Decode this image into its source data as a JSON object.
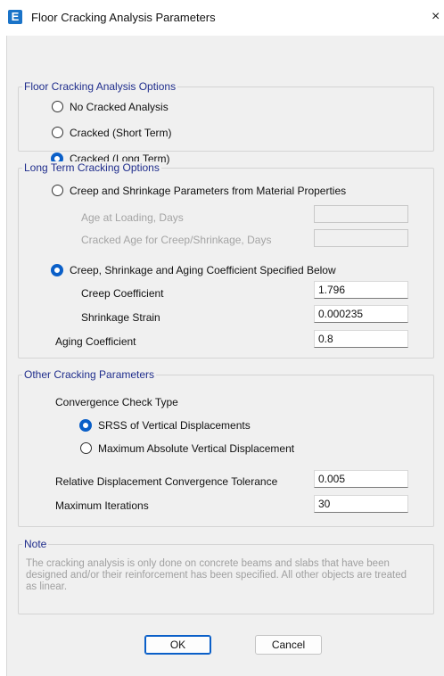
{
  "window": {
    "title": "Floor Cracking Analysis Parameters",
    "app_icon_letter": "E",
    "close_glyph": "×"
  },
  "floor_options": {
    "legend": "Floor Cracking Analysis Options",
    "items": [
      {
        "label": "No Cracked Analysis",
        "checked": false
      },
      {
        "label": "Cracked  (Short Term)",
        "checked": false
      },
      {
        "label": "Cracked  (Long Term)",
        "checked": true
      }
    ]
  },
  "long_term": {
    "legend": "Long Term Cracking Options",
    "from_material": {
      "label": "Creep and Shrinkage Parameters from Material Properties",
      "checked": false,
      "age_loading_label": "Age at Loading,  Days",
      "age_loading_value": "",
      "cracked_age_label": "Cracked Age for Creep/Shrinkage,  Days",
      "cracked_age_value": ""
    },
    "specified": {
      "label": "Creep, Shrinkage and Aging Coefficient Specified Below",
      "checked": true,
      "creep_label": "Creep Coefficient",
      "creep_value": "1.796",
      "shrinkage_label": "Shrinkage Strain",
      "shrinkage_value": "0.000235"
    },
    "aging_label": "Aging Coefficient",
    "aging_value": "0.8"
  },
  "other": {
    "legend": "Other Cracking Parameters",
    "convergence_label": "Convergence Check Type",
    "srss_label": "SRSS of Vertical Displacements",
    "srss_checked": true,
    "max_abs_label": "Maximum Absolute Vertical Displacement",
    "max_abs_checked": false,
    "tolerance_label": "Relative Displacement Convergence Tolerance",
    "tolerance_value": "0.005",
    "max_iter_label": "Maximum Iterations",
    "max_iter_value": "30"
  },
  "note": {
    "legend": "Note",
    "text": "The cracking analysis is only done on concrete beams and slabs that have been designed and/or their reinforcement has been specified. All other objects are treated as linear."
  },
  "buttons": {
    "ok": "OK",
    "cancel": "Cancel"
  },
  "colors": {
    "accent": "#0a5fc8",
    "legend": "#1f2d8c",
    "disabled_text": "#a4a4a4"
  }
}
